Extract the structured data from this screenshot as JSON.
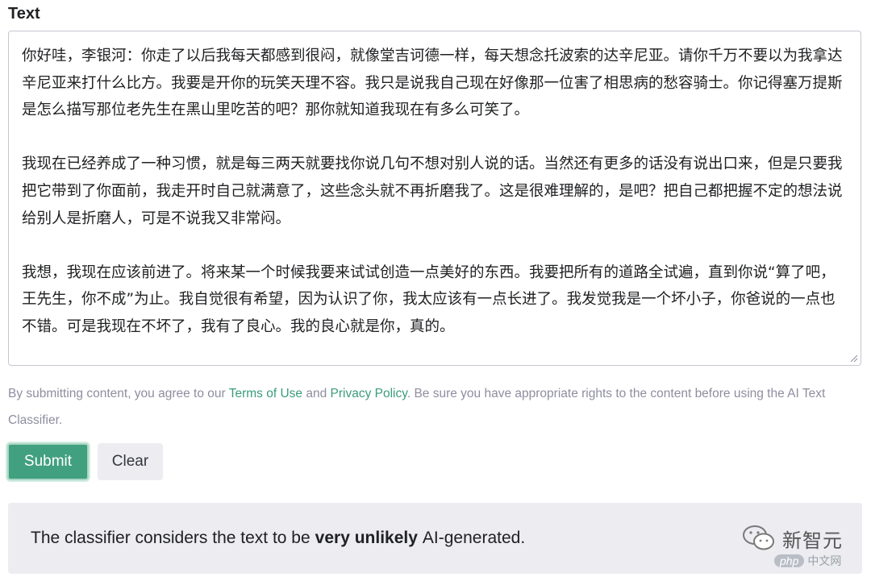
{
  "form": {
    "label": "Text",
    "paragraphs": [
      "你好哇，李银河：你走了以后我每天都感到很闷，就像堂吉诃德一样，每天想念托波索的达辛尼亚。请你千万不要以为我拿达辛尼亚来打什么比方。我要是开你的玩笑天理不容。我只是说我自己现在好像那一位害了相思病的愁容骑士。你记得塞万提斯是怎么描写那位老先生在黑山里吃苦的吧？那你就知道我现在有多么可笑了。",
      "我现在已经养成了一种习惯，就是每三两天就要找你说几句不想对别人说的话。当然还有更多的话没有说出口来，但是只要我把它带到了你面前，我走开时自己就满意了，这些念头就不再折磨我了。这是很难理解的，是吧？把自己都把握不定的想法说给别人是折磨人，可是不说我又非常闷。",
      "我想，我现在应该前进了。将来某一个时候我要来试试创造一点美好的东西。我要把所有的道路全试遍，直到你说“算了吧，王先生，你不成”为止。我自觉很有希望，因为认识了你，我太应该有一点长进了。我发觉我是一个坏小子，你爸说的一点也不错。可是我现在不坏了，我有了良心。我的良心就是你，真的。"
    ]
  },
  "notice": {
    "before": "By submitting content, you agree to our ",
    "terms_link": "Terms of Use",
    "middle": " and ",
    "privacy_link": "Privacy Policy",
    "after": ". Be sure you have appropriate rights to the content before using the AI Text Classifier."
  },
  "buttons": {
    "submit_label": "Submit",
    "clear_label": "Clear"
  },
  "result": {
    "prefix": "The classifier considers the text to be",
    "verdict": "very unlikely",
    "suffix": "AI-generated."
  },
  "watermark": {
    "name": "新智元",
    "php_badge": "php",
    "php_suffix": "中文网"
  },
  "colors": {
    "accent": "#41a07f",
    "link": "#3a9c7c",
    "muted_text": "#8e8ea0",
    "panel_bg": "#ececf1"
  },
  "icons": {
    "resize": "resize-grip-icon",
    "watermark": "wechat-logo-icon"
  }
}
